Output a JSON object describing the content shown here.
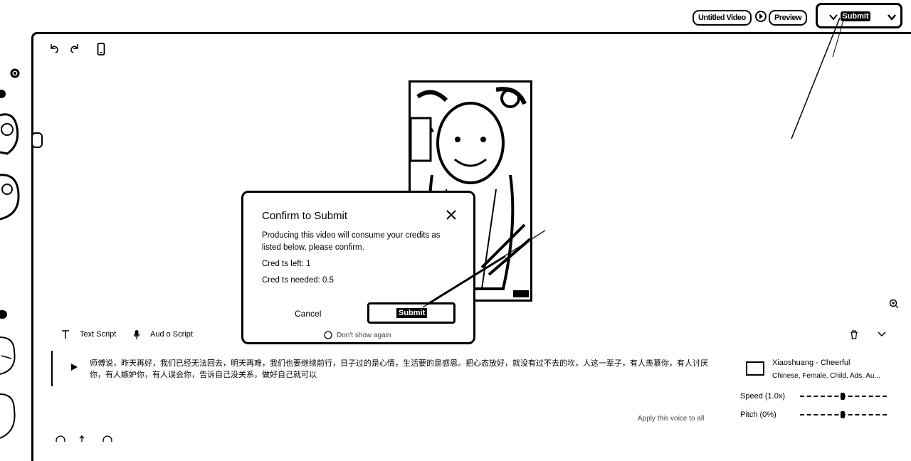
{
  "header": {
    "video_title": "Untitled Video",
    "preview_label": "Preview",
    "submit_label": "Submit"
  },
  "modal": {
    "title": "Confirm to Submit",
    "message": "Producing this video will consume your credits as listed below, please confirm.",
    "credits_left": "Cred ts left: 1",
    "credits_needed": "Cred ts needed: 0.5",
    "cancel_label": "Cancel",
    "submit_label": "Submit",
    "dont_show_label": "Don't show again"
  },
  "script_panel": {
    "text_script_label": "Text Script",
    "audio_script_label": "Aud o Script",
    "script_text": "师傅说，昨天再好，我们已经无法回去，明天再难，我们也要继续前行，日子过的是心情，生活要的是感恩。把心态放好，就没有过不去的坎，人这一辈子，有人羡慕你，有人讨厌你，有人嫉妒你，有人误会你，告诉自己没关系，做好自己就可以",
    "apply_voice_label": "Apply this voice to all"
  },
  "voice": {
    "name": "Xiaoshuang - Cheerful",
    "description": "Chinese, Female, Child, Ads, Au...",
    "speed_label": "Speed (1.0x)",
    "pitch_label": "Pitch (0%)"
  },
  "icons": [
    "undo-icon",
    "redo-icon",
    "mobile-icon",
    "gear-icon",
    "zoom-in-icon",
    "trash-icon",
    "chevron-down-icon",
    "play-icon",
    "text-icon",
    "mic-icon",
    "close-icon"
  ]
}
